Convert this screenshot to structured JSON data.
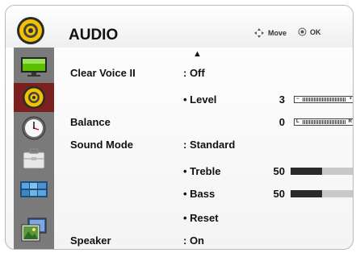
{
  "header": {
    "title": "AUDIO",
    "hint_move": "Move",
    "hint_ok": "OK",
    "icon": "speaker-icon"
  },
  "sidebar": {
    "items": [
      {
        "icon": "picture-icon",
        "active": false
      },
      {
        "icon": "audio-icon",
        "active": true
      },
      {
        "icon": "clock-icon",
        "active": false
      },
      {
        "icon": "option-icon",
        "active": false
      },
      {
        "icon": "channel-icon",
        "active": false
      },
      {
        "icon": "input-icon",
        "active": false
      }
    ]
  },
  "menu": {
    "clear_voice": {
      "label": "Clear Voice II",
      "value": ": Off"
    },
    "level": {
      "label": "• Level",
      "value": "3"
    },
    "balance": {
      "label": "Balance",
      "value": "0",
      "left_mark": "L",
      "right_mark": "R"
    },
    "sound_mode": {
      "label": "Sound Mode",
      "value": ": Standard"
    },
    "treble": {
      "label": "• Treble",
      "value": "50",
      "fraction": 0.5
    },
    "bass": {
      "label": "• Bass",
      "value": "50",
      "fraction": 0.5
    },
    "reset": {
      "label": "• Reset"
    },
    "speaker": {
      "label": "Speaker",
      "value": ": On"
    }
  },
  "colors": {
    "active_tab": "#7b1f1f",
    "sidebar": "#7a7a7a"
  }
}
